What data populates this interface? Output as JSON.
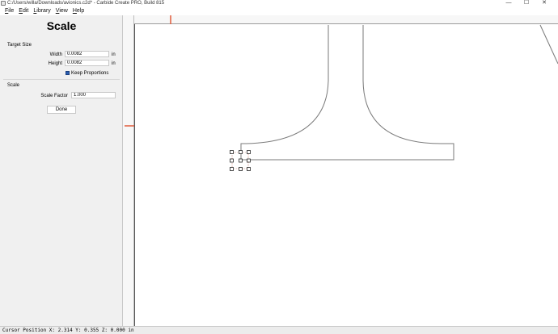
{
  "window": {
    "title": "C:/Users/willa/Downloads/avionics.c2d* - Carbide Create PRO, Build 815",
    "minimize_glyph": "—",
    "maximize_glyph": "☐",
    "close_glyph": "✕"
  },
  "menu": {
    "file_key": "F",
    "file_rest": "ile",
    "edit_key": "E",
    "edit_rest": "dit",
    "library_key": "L",
    "library_rest": "ibrary",
    "view_key": "V",
    "view_rest": "iew",
    "help_key": "H",
    "help_rest": "elp"
  },
  "panel": {
    "title": "Scale",
    "target_size_label": "Target Size",
    "width_label": "Width",
    "width_value": "0.0082",
    "width_unit": "in",
    "height_label": "Height",
    "height_value": "0.0082",
    "height_unit": "in",
    "keep_proportions_label": "Keep Proportions",
    "keep_proportions_checked": true,
    "scale_section_label": "Scale",
    "scale_factor_label": "Scale Factor",
    "scale_factor_value": "1.000",
    "done_label": "Done"
  },
  "status": {
    "cursor_position": "Cursor Position X: 2.314 Y: 0.355 Z: 0.000 in"
  },
  "colors": {
    "accent_marker": "#e05a3a",
    "checkbox_blue": "#2a5db0",
    "shape_stroke": "#7a7a7a",
    "selection_stroke": "#222222"
  },
  "icons": {
    "app": "carbide-create-icon",
    "checkbox": "checkbox-checked-icon"
  }
}
